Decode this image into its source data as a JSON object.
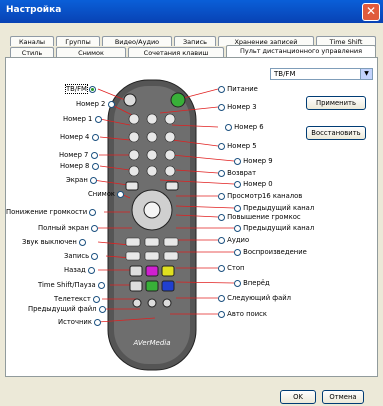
{
  "window": {
    "title": "Настройка",
    "close_icon": "close-icon"
  },
  "tabs_top": [
    "Каналы",
    "Группы",
    "Видео/Аудио",
    "Запись",
    "Хранение записей",
    "Time Shift"
  ],
  "tabs_bottom": [
    "Стиль",
    "Снимок",
    "Сочетания клавиш",
    "Пульт дистанционного управления"
  ],
  "remote_select": {
    "value": "TB/FM"
  },
  "buttons": {
    "apply": "Применить",
    "restore": "Восстановить",
    "ok": "OK",
    "cancel": "Отмена"
  },
  "left_labels": {
    "tvfm": "TB/FM",
    "num2": "Номер 2",
    "num1": "Номер 1",
    "num4": "Номер 4",
    "num7": "Номер 7",
    "num8": "Номер 8",
    "screen": "Экран",
    "snapshot": "Снимок",
    "vol_up": "Понижение громкости",
    "fullscreen": "Полный экран",
    "mute": "Звук выключен",
    "record": "Запись",
    "back": "Назад",
    "timeshift": "Time Shift/Пауза",
    "teletext": "Телетекст",
    "prev_file": "Предыдущий файл",
    "source": "Источник"
  },
  "right_labels": {
    "power": "Питание",
    "num3": "Номер 3",
    "num6": "Номер 6",
    "num5": "Номер 5",
    "num9": "Номер 9",
    "return": "Возврат",
    "num0": "Номер 0",
    "preview16": "Просмотр16 каналов",
    "prev_ch": "Предыдущий канал",
    "vol_up_r": "Повышение громкос",
    "prev_ch2": "Предыдущий канал",
    "audio": "Аудио",
    "play": "Воспроизведение",
    "stop": "Стоп",
    "forward": "Вперёд",
    "next_file": "Следующий файл",
    "autosearch": "Авто поиск"
  },
  "remote": {
    "brand": "AVerMedia",
    "labels": [
      "VOL",
      "CH",
      "FULL",
      "SCREEN",
      "SNAPSHOT"
    ]
  },
  "colors": {
    "title_bar": "#0842b4",
    "remote_body": "#4a4a4a",
    "accent_green": "#38b038",
    "accent_magenta": "#d020d0",
    "accent_yellow": "#e0e020",
    "accent_blue": "#2040d0"
  }
}
